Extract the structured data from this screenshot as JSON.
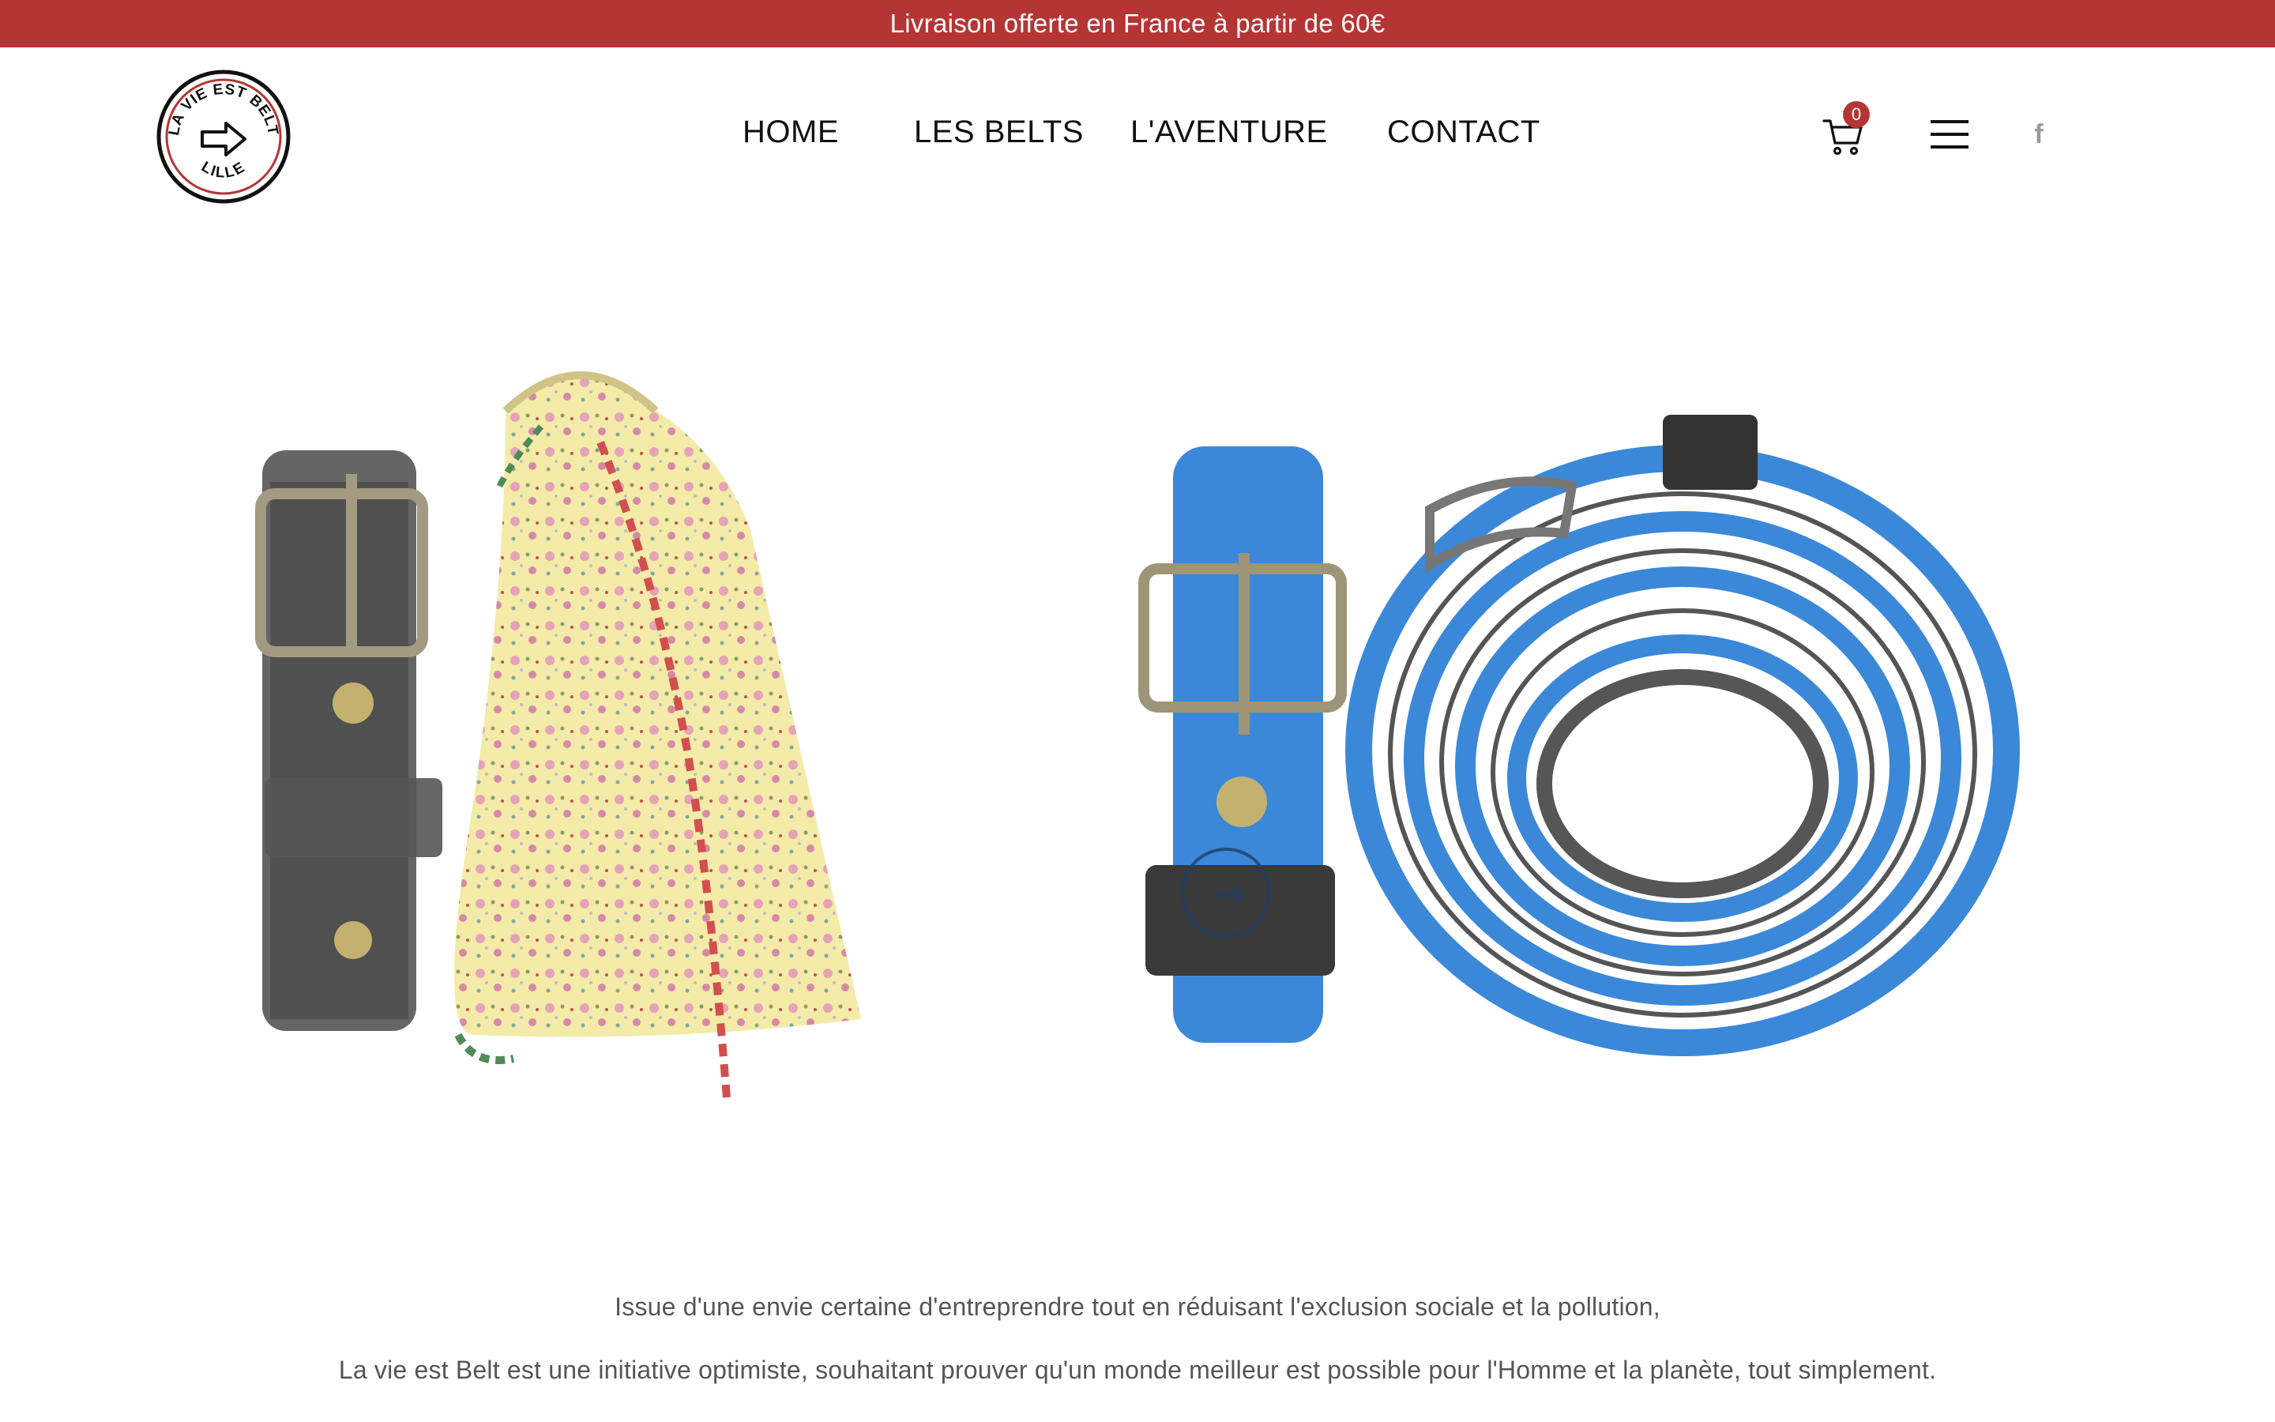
{
  "promo": {
    "text": "Livraison offerte en France à partir de 60€"
  },
  "brand": {
    "logo_top_text": "LA VIE EST BELT",
    "logo_bottom_text": "LILLE",
    "accent_color": "#b53535"
  },
  "nav": {
    "items": [
      {
        "label": "HOME"
      },
      {
        "label": "LES BELTS"
      },
      {
        "label": "L'AVENTURE"
      },
      {
        "label": "CONTACT"
      }
    ]
  },
  "header_icons": {
    "cart_count": "0",
    "cart_icon": "cart-icon",
    "menu_icon": "hamburger-icon",
    "social_icon": "facebook-icon",
    "social_glyph": "f"
  },
  "hero": {
    "products": [
      "black-belt-buckle",
      "floral-pouch",
      "blue-belt-buckle",
      "blue-belt-rolled"
    ]
  },
  "intro": {
    "line1": "Issue d'une envie certaine d'entreprendre tout en réduisant l'exclusion sociale et la pollution,",
    "line2": "La vie est Belt est une initiative optimiste, souhaitant prouver qu'un monde meilleur est possible pour l'Homme et la planète, tout simplement."
  }
}
